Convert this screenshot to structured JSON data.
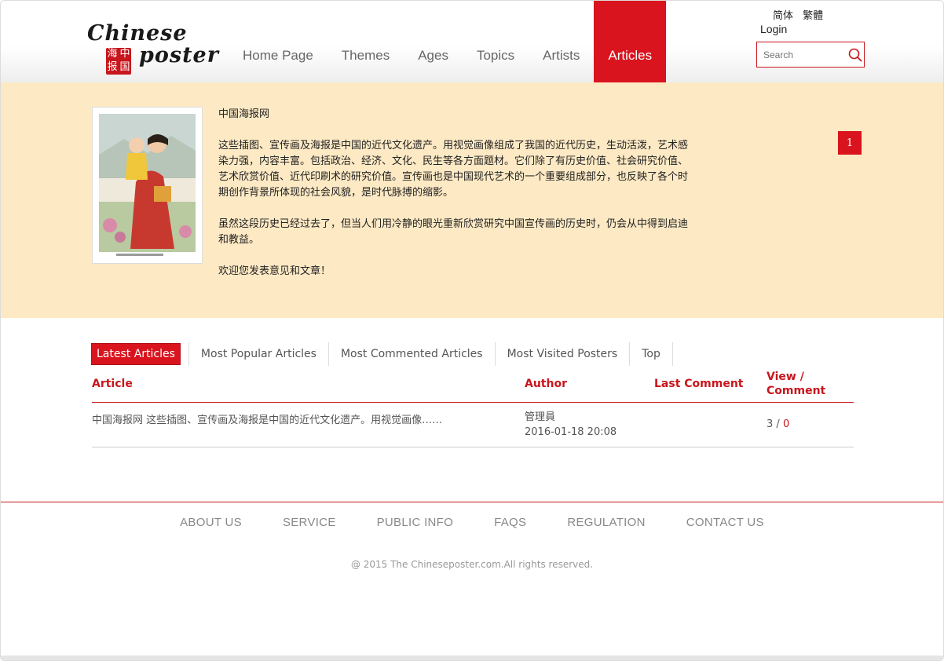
{
  "header": {
    "logo_top": "Chinese",
    "logo_bottom": "poster",
    "seal": [
      "海",
      "中",
      "报",
      "国"
    ],
    "nav": [
      "Home Page",
      "Themes",
      "Ages",
      "Topics",
      "Artists",
      "Articles"
    ],
    "active_nav": "Articles",
    "lang_simplified": "简体",
    "lang_traditional": "繁體",
    "login": "Login",
    "search_placeholder": "Search"
  },
  "banner": {
    "title": "中国海报网",
    "paragraph1": "这些插图、宣传画及海报是中国的近代文化遗产。用视觉画像组成了我国的近代历史，生动活泼，艺术感染力强，内容丰富。包括政治、经济、文化、民生等各方面题材。它们除了有历史价值、社会研究价值、艺术欣赏价值、近代印刷术的研究价值。宣传画也是中国现代艺术的一个重要组成部分，也反映了各个时期创作背景所体现的社会风貌，是时代脉搏的缩影。",
    "paragraph2": "虽然这段历史已经过去了，但当人们用冷静的眼光重新欣赏研究中国宣传画的历史时，仍会从中得到启迪和教益。",
    "paragraph3": "欢迎您发表意见和文章！",
    "page_number": "1"
  },
  "tabs": [
    "Latest Articles",
    "Most Popular Articles",
    "Most Commented Articles",
    "Most Visited Posters",
    "Top"
  ],
  "table": {
    "headers": {
      "article": "Article",
      "author": "Author",
      "last_comment": "Last Comment",
      "view_comment_line1": "View /",
      "view_comment_line2": "Comment"
    },
    "rows": [
      {
        "article": "中国海报网 这些插图、宣传画及海报是中国的近代文化遗产。用视觉画像……",
        "author": "管理員",
        "date": "2016-01-18 20:08",
        "last_comment": "",
        "views": "3",
        "separator": " / ",
        "comments": "0"
      }
    ]
  },
  "footer": {
    "links": [
      "ABOUT US",
      "SERVICE",
      "PUBLIC INFO",
      "FAQS",
      "REGULATION",
      "CONTACT US"
    ],
    "copyright": "@ 2015 The Chineseposter.com.All rights reserved."
  },
  "colors": {
    "accent": "#d9141e",
    "banner_bg": "#fde9c4"
  }
}
